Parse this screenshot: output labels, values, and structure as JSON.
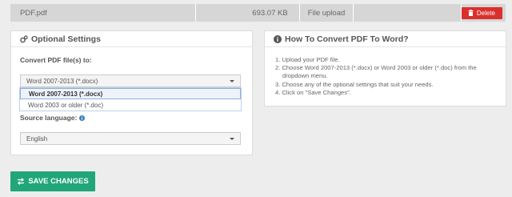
{
  "file": {
    "name": "PDF.pdf",
    "size": "693.07 KB",
    "source": "File upload",
    "delete_label": "Delete"
  },
  "optional_settings": {
    "title": "Optional Settings",
    "convert_label": "Convert PDF file(s) to:",
    "convert_selected": "Word 2007-2013 (*.docx)",
    "convert_options": [
      "Word 2007-2013 (*.docx)",
      "Word 2003 or older (*.doc)"
    ],
    "source_language_label": "Source language:",
    "source_language_selected": "English"
  },
  "how_to": {
    "title": "How To Convert PDF To Word?",
    "steps": [
      "1. Upload your PDF file.",
      "2. Choose Word 2007-2013 (*.docx) or Word 2003 or older (*.doc) from the",
      "dropdown menu.",
      "3. Choose any of the optional settings that suit your needs.",
      "4. Click on \"Save Changes\"."
    ]
  },
  "save_label": "SAVE CHANGES",
  "colors": {
    "delete": "#d9302c",
    "save": "#21a67a"
  }
}
